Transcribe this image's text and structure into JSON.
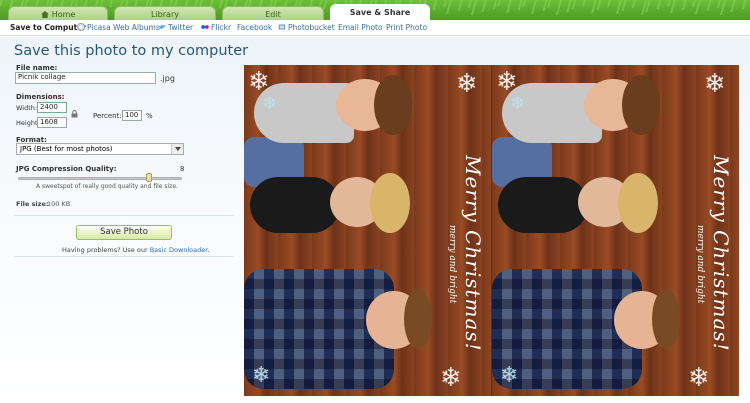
{
  "tabs": [
    {
      "label": "Home",
      "icon": "home-icon"
    },
    {
      "label": "Library"
    },
    {
      "label": "Edit"
    },
    {
      "label": "Save & Share",
      "active": true
    }
  ],
  "subnav": [
    {
      "label": "Save to Computer",
      "active": true
    },
    {
      "label": "Picasa Web Albums",
      "icon": "picasa-icon"
    },
    {
      "label": "Twitter",
      "icon": "twitter-icon"
    },
    {
      "label": "Flickr",
      "icon": "flickr-icon"
    },
    {
      "label": "Facebook"
    },
    {
      "label": "Photobucket",
      "icon": "photobucket-icon"
    },
    {
      "label": "Email Photo"
    },
    {
      "label": "Print Photo"
    }
  ],
  "form": {
    "title": "Save this photo to my computer",
    "file_name_label": "File name:",
    "file_name_value": "Picnik collage",
    "file_ext": ".jpg",
    "dimensions_label": "Dimensions:",
    "width_label": "Width:",
    "width_value": "2400",
    "height_label": "Height:",
    "height_value": "1608",
    "percent_label": "Percent:",
    "percent_value": "100",
    "percent_unit": "%",
    "format_label": "Format:",
    "format_value": "JPG  (Best for most photos)",
    "quality_label": "JPG Compression Quality:",
    "quality_value": "8",
    "quality_level": 0.8,
    "quality_hint": "A sweetspot of really good quality and file size.",
    "file_size_label": "File size:",
    "file_size_value": "100 KB",
    "save_button": "Save Photo",
    "problems_text": "Having problems? Use our ",
    "problems_link": "Basic Downloader",
    "problems_end": "."
  },
  "photo": {
    "script_title": "Merry Christmas!",
    "script_sub": "merry and bright"
  },
  "colors": {
    "grass": "#5aa82c",
    "title": "#2a5676",
    "link": "#3a6e98",
    "save_button": "#d7eaa6"
  }
}
